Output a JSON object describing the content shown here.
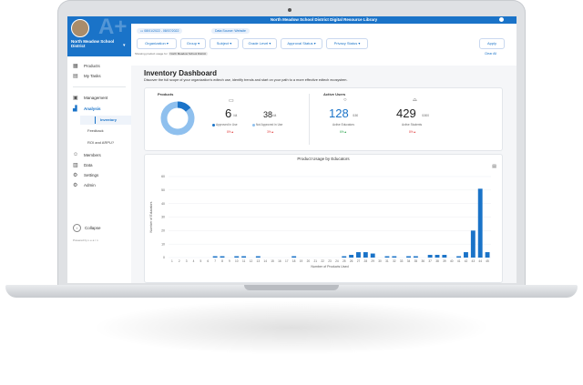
{
  "app": {
    "title": "North Meadow School District Digital Resource Library",
    "district_name": "North Meadow School District"
  },
  "sidebar": {
    "items": [
      {
        "icon": "grid-icon",
        "label": "Products"
      },
      {
        "icon": "clipboard-icon",
        "label": "My Tasks"
      },
      {
        "icon": "briefcase-icon",
        "label": "Management"
      },
      {
        "icon": "bar-chart-icon",
        "label": "Analysis"
      },
      {
        "icon": "",
        "label": "Inventory"
      },
      {
        "icon": "",
        "label": "Feedback"
      },
      {
        "icon": "",
        "label": "ROI and ARPU?"
      },
      {
        "icon": "people-icon",
        "label": "Members"
      },
      {
        "icon": "database-icon",
        "label": "Data"
      },
      {
        "icon": "gear-icon",
        "label": "Settings"
      },
      {
        "icon": "gear-icon",
        "label": "Admin"
      }
    ],
    "collapse_label": "Collapse",
    "powered_by": "Powered by L e a r n"
  },
  "filters": {
    "date_chip": "08/01/2022 - 08/07/2022",
    "source_chip": "Data Source: Website",
    "buttons": [
      "Organization ▾",
      "Group ▾",
      "Subject ▾",
      "Grade Level ▾",
      "Approval Status ▾",
      "Privacy Status ▾"
    ],
    "apply_label": "Apply",
    "showing_text": "Showing product usage for",
    "showing_tag": "North Meadow School District",
    "clear_all": "Clear All"
  },
  "dashboard": {
    "title": "Inventory Dashboard",
    "subtitle": "Discover the full scope of your organization's edtech use, identify trends and start on your path to a more effective edtech ecosystem."
  },
  "products_card": {
    "title": "Products",
    "approved_count": "6",
    "approved_unit": "/44",
    "approved_label": "Approved in Use",
    "approved_delta": "8%▲",
    "not_approved_count": "38",
    "not_approved_unit": "/44",
    "not_approved_label": "Not Approved in Use",
    "not_approved_delta": "3%▲",
    "donut_approved_fraction": 0.14
  },
  "active_users_card": {
    "title": "Active Users",
    "educators_count": "128",
    "educators_unit": "/150",
    "educators_label": "Active Educators",
    "educators_delta": "6%▲",
    "students_count": "429",
    "students_unit": "/1500",
    "students_label": "Active Students",
    "students_delta": "8%▲"
  },
  "chart_data": {
    "type": "bar",
    "title": "Product Usage by Educators",
    "xlabel": "Number of Products Used",
    "ylabel": "Number of Educators",
    "ylim": [
      0,
      60
    ],
    "yticks": [
      0,
      10,
      20,
      30,
      40,
      50,
      60
    ],
    "categories": [
      "1",
      "2",
      "3",
      "4",
      "5",
      "6",
      "7",
      "8",
      "9",
      "10",
      "11",
      "12",
      "13",
      "14",
      "15",
      "16",
      "17",
      "18",
      "19",
      "20",
      "21",
      "22",
      "23",
      "24",
      "25",
      "26",
      "27",
      "28",
      "29",
      "30",
      "31",
      "32",
      "33",
      "34",
      "35",
      "36",
      "37",
      "38",
      "39",
      "40",
      "41",
      "42",
      "43",
      "44",
      "45"
    ],
    "values": [
      0,
      0,
      0,
      0,
      0,
      0,
      1,
      1,
      0,
      1,
      1,
      0,
      1,
      0,
      0,
      0,
      0,
      1,
      0,
      0,
      0,
      0,
      0,
      0,
      1,
      2,
      4,
      4,
      3,
      0,
      1,
      1,
      0,
      1,
      1,
      0,
      2,
      2,
      2,
      0,
      1,
      4,
      20,
      51,
      4
    ],
    "bar_color": "#1a73c8"
  }
}
